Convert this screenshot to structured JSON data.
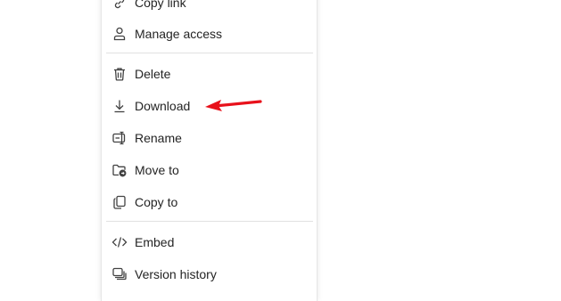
{
  "menu": {
    "items": [
      {
        "label": "Copy link",
        "icon": "link-icon"
      },
      {
        "label": "Manage access",
        "icon": "person-icon"
      },
      {
        "label": "Delete",
        "icon": "trash-icon"
      },
      {
        "label": "Download",
        "icon": "download-icon"
      },
      {
        "label": "Rename",
        "icon": "rename-icon"
      },
      {
        "label": "Move to",
        "icon": "folder-move-icon"
      },
      {
        "label": "Copy to",
        "icon": "copy-icon"
      },
      {
        "label": "Embed",
        "icon": "code-icon"
      },
      {
        "label": "Version history",
        "icon": "version-history-icon"
      }
    ]
  },
  "annotation": {
    "arrow_color": "#e8111b",
    "points_to": "Download"
  },
  "colors": {
    "text": "#242424",
    "icon": "#424242",
    "divider": "#e1e1e1"
  }
}
